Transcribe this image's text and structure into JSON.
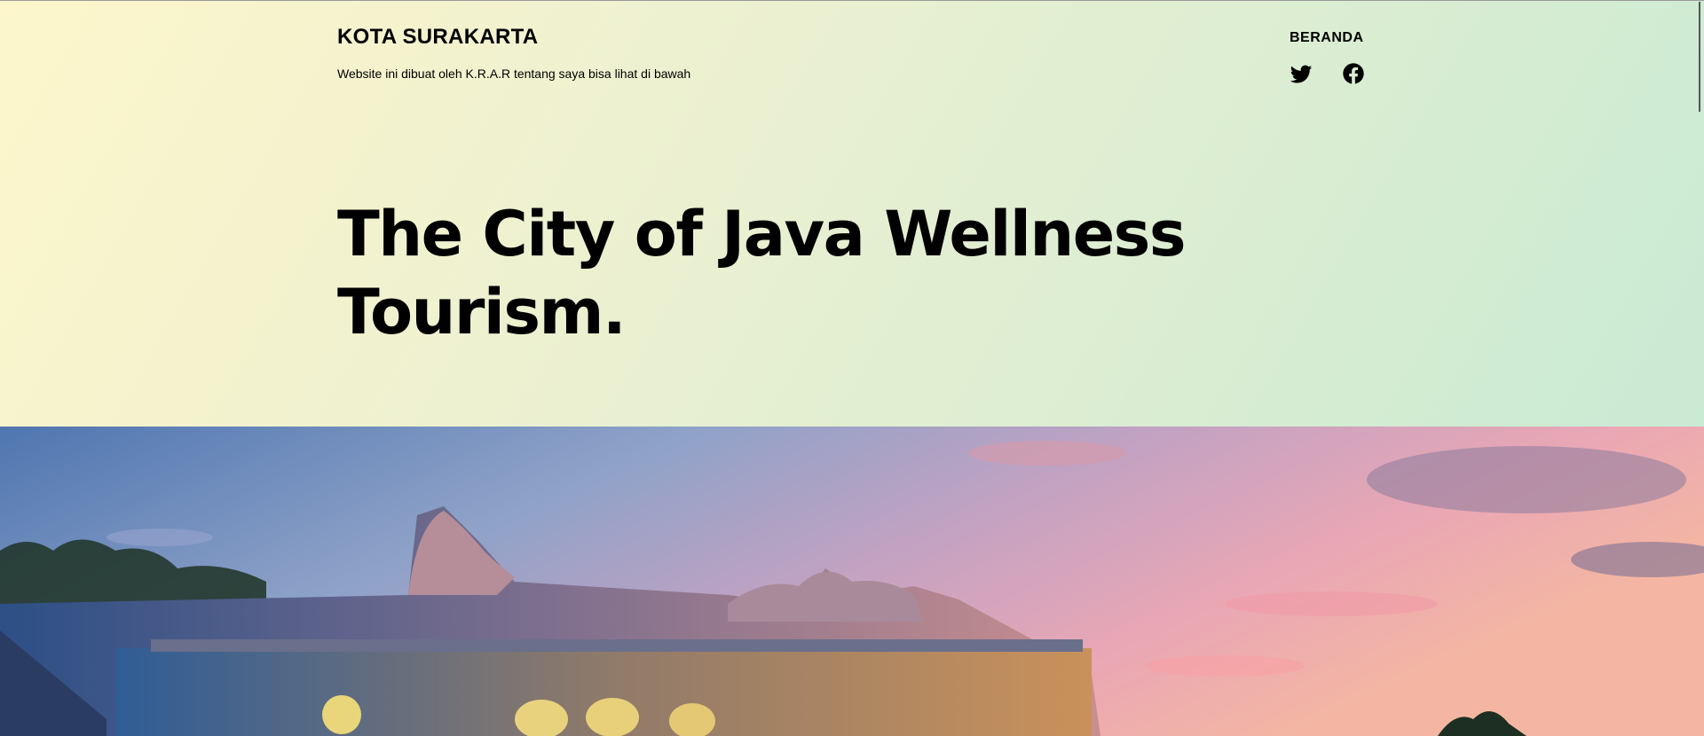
{
  "site": {
    "title": "KOTA SURAKARTA",
    "tagline": "Website ini dibuat oleh K.R.A.R tentang saya bisa lihat di bawah"
  },
  "nav": {
    "home_label": "BERANDA"
  },
  "social": {
    "twitter_icon": "twitter-icon",
    "facebook_icon": "facebook-icon"
  },
  "hero": {
    "headline": "The City of Java Wellness Tourism."
  },
  "cover_image": {
    "description_icon": "palace-roof-sunset-photo"
  },
  "colors": {
    "gradient_start": "#fdf6cb",
    "gradient_end": "#c9ead3",
    "text": "#000000"
  }
}
